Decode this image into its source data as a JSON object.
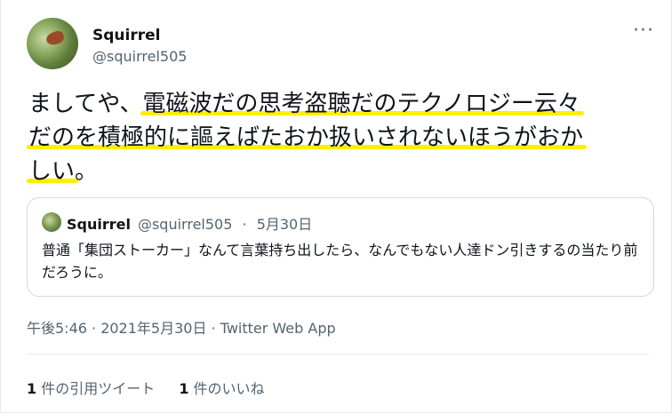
{
  "author": {
    "display_name": "Squirrel",
    "handle": "@squirrel505"
  },
  "more_icon": "more-horizontal-icon",
  "tweet": {
    "lines": [
      {
        "plain": "ましてや、",
        "highlight": "電磁波だの思考盗聴だのテクノロジー云々"
      },
      {
        "plain": "",
        "highlight": "だのを積極的に謳えばたおか扱いされないほうがおか"
      },
      {
        "plain": "",
        "highlight": "しい",
        "tail": "。"
      }
    ]
  },
  "quote": {
    "display_name": "Squirrel",
    "handle": "@squirrel505",
    "separator": "·",
    "date": "5月30日",
    "body": "普通「集団ストーカー」なんて言葉持ち出したら、なんでもない人達ドン引きするの当たり前だろうに。"
  },
  "meta": {
    "timestamp": "午後5:46 · 2021年5月30日 · Twitter Web App"
  },
  "stats": {
    "quote_count": "1",
    "quote_label": " 件の引用ツイート",
    "like_count": "1",
    "like_label": " 件のいいね"
  },
  "colors": {
    "highlight": "#ffee00",
    "secondary_text": "#536471",
    "border": "#cfd9de"
  }
}
